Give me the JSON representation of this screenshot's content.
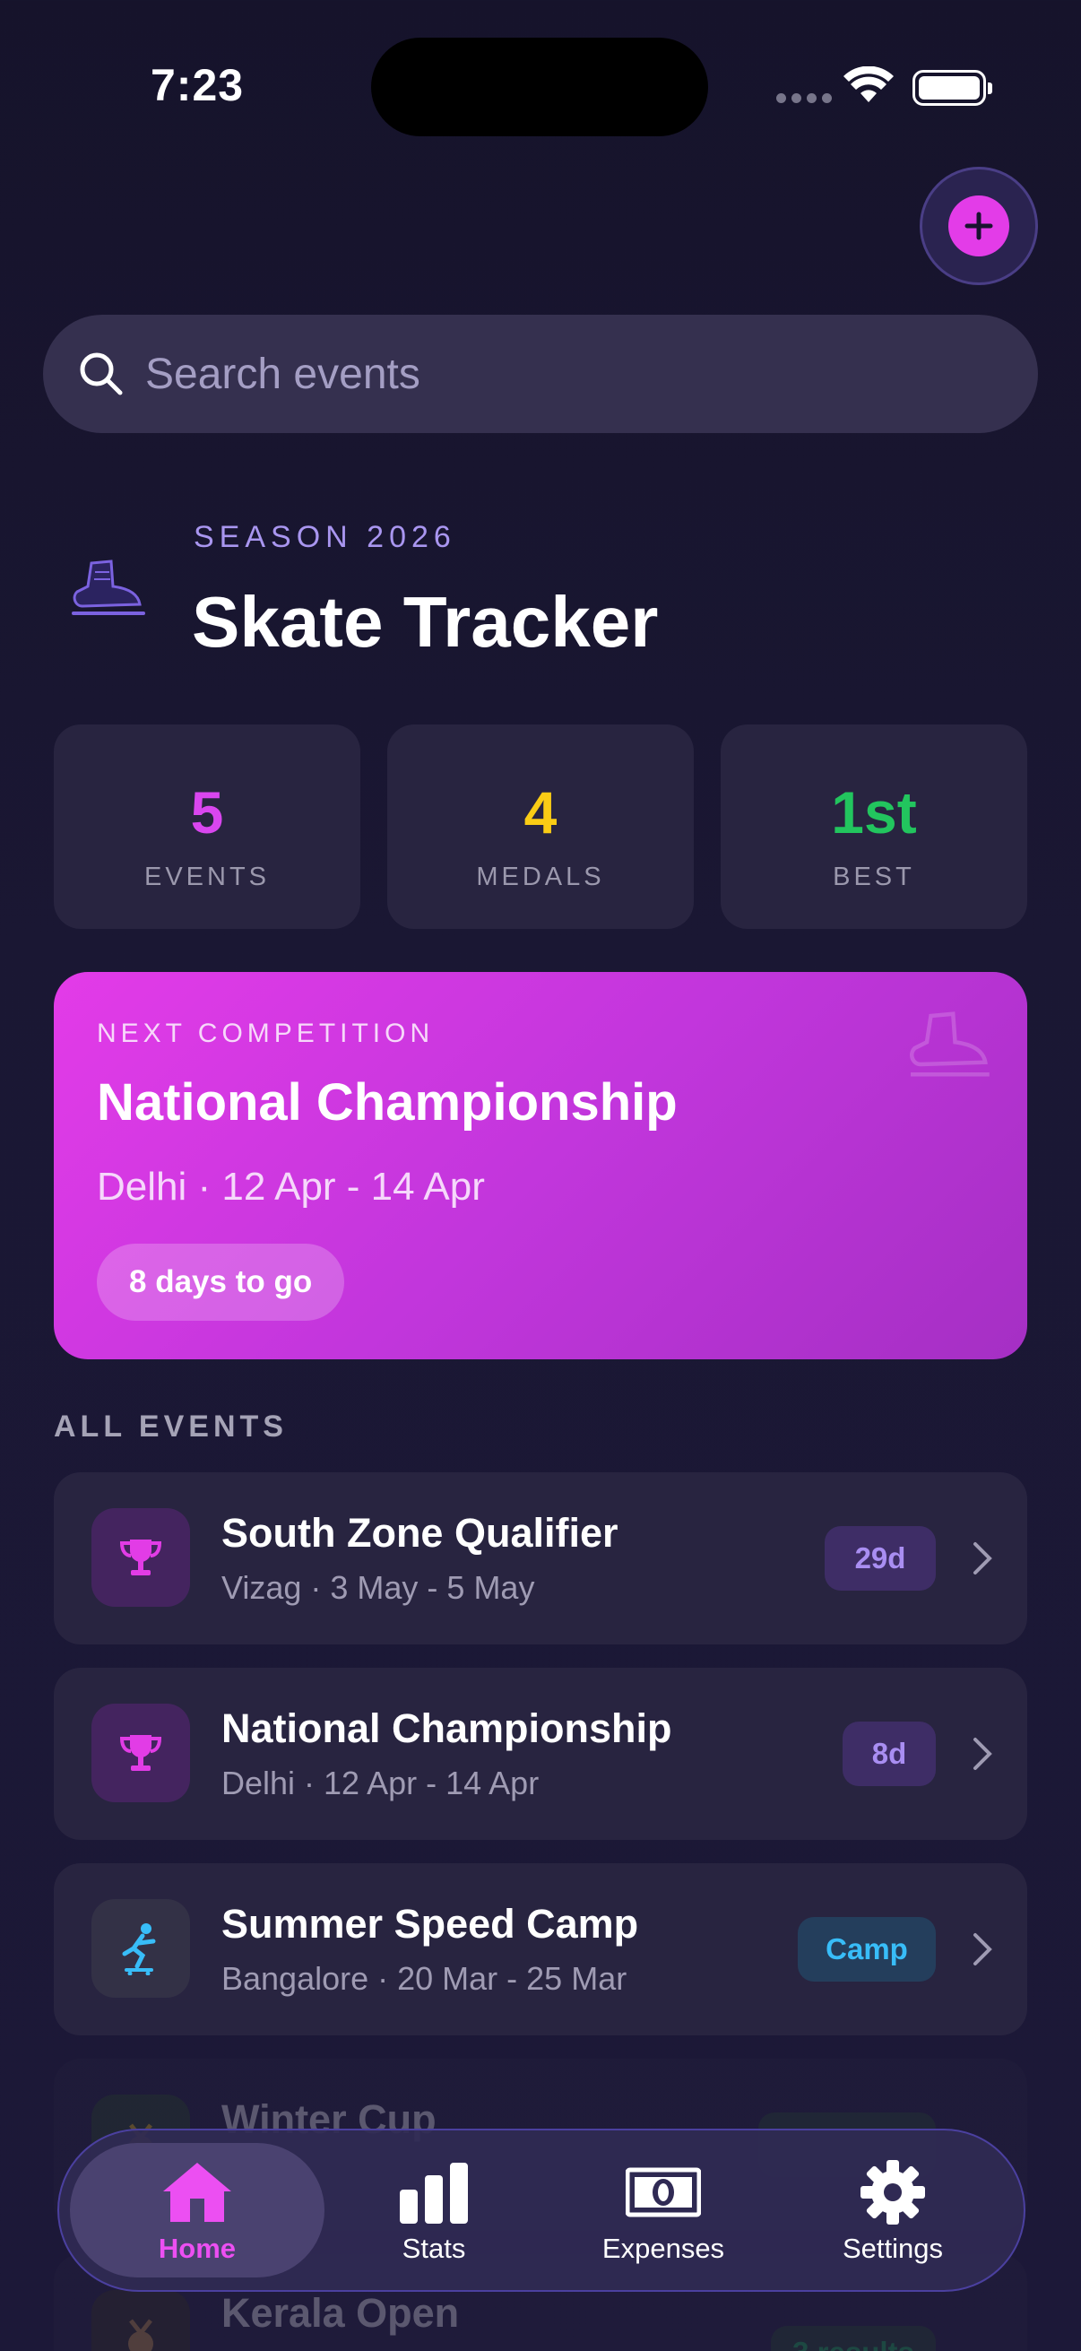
{
  "status": {
    "time": "7:23"
  },
  "search": {
    "placeholder": "Search events"
  },
  "header": {
    "season": "SEASON 2026",
    "title": "Skate Tracker"
  },
  "stats": [
    {
      "value": "5",
      "label": "EVENTS",
      "color": "#d946ef"
    },
    {
      "value": "4",
      "label": "MEDALS",
      "color": "#facc15"
    },
    {
      "value": "1st",
      "label": "BEST",
      "color": "#22c55e"
    }
  ],
  "next_competition": {
    "eyebrow": "NEXT COMPETITION",
    "title": "National Championship",
    "meta": "Delhi · 12 Apr - 14 Apr",
    "countdown": "8 days to go"
  },
  "events_section": {
    "title": "ALL EVENTS"
  },
  "events": [
    {
      "name": "South Zone Qualifier",
      "meta": "Vizag · 3 May - 5 May",
      "badge": "29d",
      "icon": "trophy-icon"
    },
    {
      "name": "National Championship",
      "meta": "Delhi · 12 Apr - 14 Apr",
      "badge": "8d",
      "icon": "trophy-icon"
    },
    {
      "name": "Summer Speed Camp",
      "meta": "Bangalore · 20 Mar - 25 Mar",
      "badge": "Camp",
      "icon": "skater-icon"
    },
    {
      "name": "Winter Cup",
      "meta": "",
      "badge": "",
      "icon": "medal-icon"
    },
    {
      "name": "Kerala Open",
      "meta": "",
      "badge": "3 results",
      "icon": "medal-icon"
    }
  ],
  "tabs": [
    {
      "label": "Home",
      "icon": "home-icon",
      "active": true
    },
    {
      "label": "Stats",
      "icon": "bar-chart-icon"
    },
    {
      "label": "Expenses",
      "icon": "banknote-icon"
    },
    {
      "label": "Settings",
      "icon": "gear-icon"
    }
  ],
  "colors": {
    "accent": "#e33ce8",
    "background": "#17142d",
    "card": "#282440"
  }
}
